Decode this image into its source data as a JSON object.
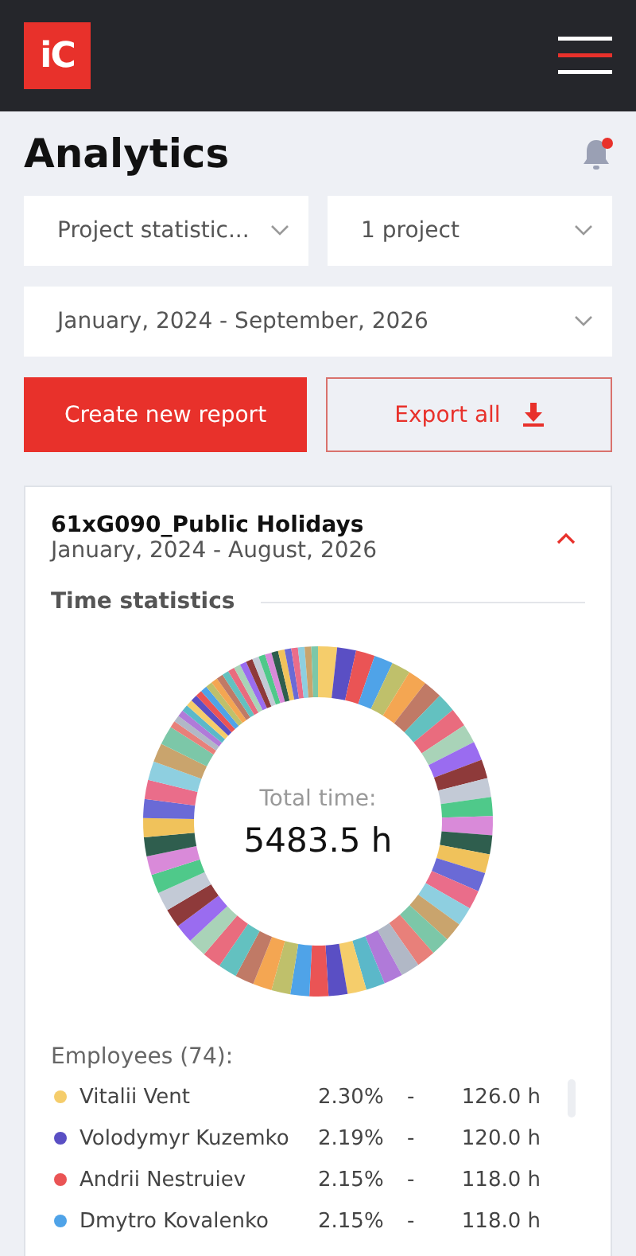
{
  "header": {
    "logo": "iC"
  },
  "page": {
    "title": "Analytics",
    "has_notifications": true
  },
  "filters": [
    {
      "value": "Project statistic..."
    },
    {
      "value": "1 project"
    },
    {
      "value": "January, 2024 - September, 2026"
    }
  ],
  "buttons": {
    "create": "Create new report",
    "export": "Export all"
  },
  "report": {
    "title": "61xG090_Public Holidays",
    "period": "January, 2024 - August, 2026",
    "expanded": true,
    "section": "Time statistics",
    "total_label": "Total time:",
    "total_value": "5483.5 h",
    "employees_label": "Employees (74):",
    "employees": [
      {
        "name": "Vitalii Vent",
        "percent": "2.30%",
        "hours": "126.0 h",
        "separator": "-",
        "color": "#f5cd6b"
      },
      {
        "name": "Volodymyr Kuzemko",
        "percent": "2.19%",
        "hours": "120.0 h",
        "separator": "-",
        "color": "#5a4fc4"
      },
      {
        "name": "Andrii Nestruiev",
        "percent": "2.15%",
        "hours": "118.0 h",
        "separator": "-",
        "color": "#ea5455"
      },
      {
        "name": "Dmytro Kovalenko",
        "percent": "2.15%",
        "hours": "118.0 h",
        "separator": "-",
        "color": "#4fa3e8"
      }
    ]
  }
}
